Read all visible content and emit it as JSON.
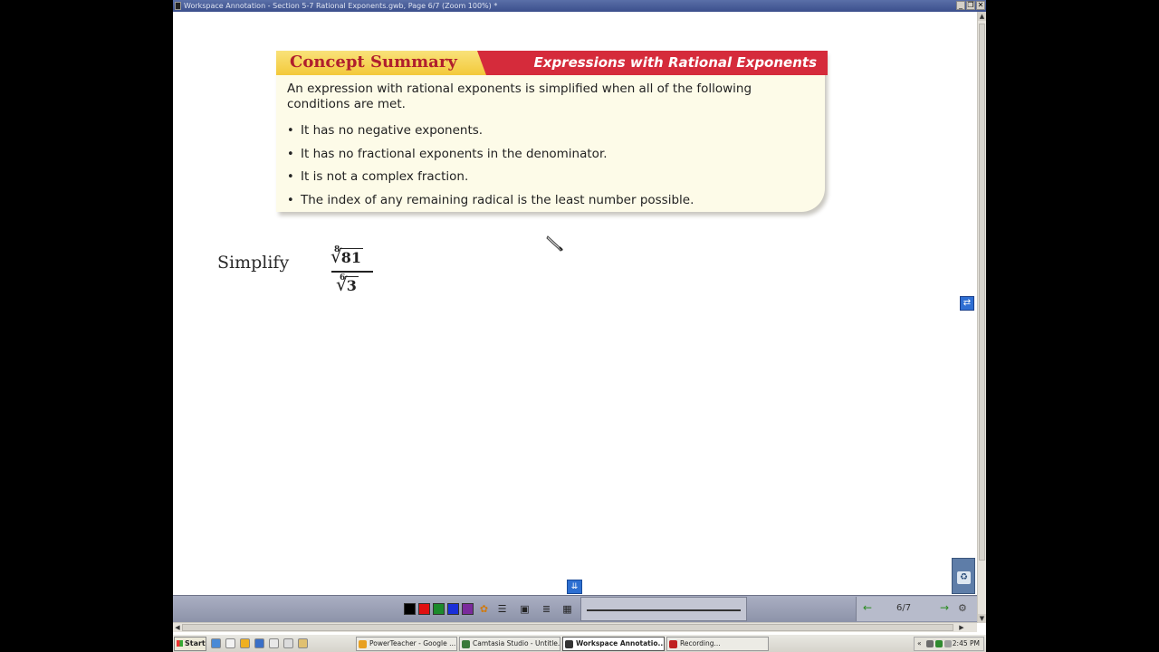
{
  "window": {
    "title": "Workspace Annotation - Section 5-7 Rational Exponents.gwb, Page 6/7  (Zoom 100%) *",
    "minimize": "_",
    "restore": "❐",
    "close": "✕"
  },
  "concept_summary": {
    "title": "Concept Summary",
    "subtitle": "Expressions with Rational Exponents",
    "intro": "An expression with rational exponents is simplified when all of the following conditions are met.",
    "bullets": [
      "It has no negative exponents.",
      "It has no fractional exponents in the denominator.",
      "It is not a complex fraction.",
      "The index of any remaining radical is the least number possible."
    ]
  },
  "problem": {
    "label": "Simplify",
    "numerator": {
      "index": "8",
      "radicand": "81"
    },
    "denominator": {
      "index": "6",
      "radicand": "3"
    }
  },
  "toolbar": {
    "colors": [
      "#000000",
      "#e01010",
      "#1c8a2c",
      "#1a2fd9",
      "#7a2a9c"
    ],
    "page_indicator": "6/7",
    "prev_icon": "←",
    "next_icon": "→"
  },
  "taskbar": {
    "start": "Start",
    "tasks": [
      {
        "label": "PowerTeacher - Google ...",
        "icon_color": "#e8a020"
      },
      {
        "label": "Camtasia Studio - Untitle...",
        "icon_color": "#3a7a3a"
      },
      {
        "label": "Workspace Annotatio...",
        "icon_color": "#333333"
      },
      {
        "label": "Recording...",
        "icon_color": "#c02020"
      }
    ],
    "tray_chevron": "«",
    "clock": "2:45 PM"
  }
}
